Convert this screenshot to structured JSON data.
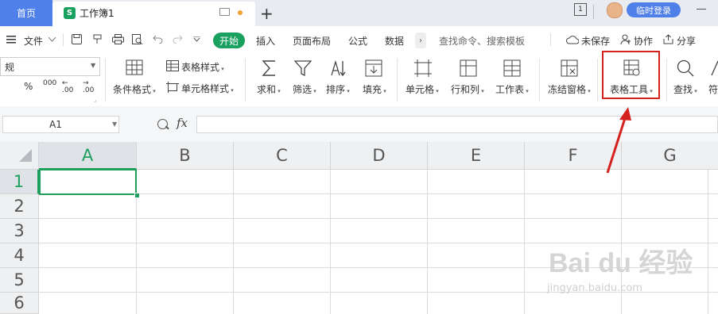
{
  "titlebar": {
    "home_tab": "首页",
    "doc_icon_letter": "S",
    "doc_title": "工作簿1",
    "new_tab": "+",
    "window_number": "1",
    "login_button": "临时登录"
  },
  "menubar": {
    "file_menu": "文件",
    "start_tab": "开始",
    "items": [
      "插入",
      "页面布局",
      "公式",
      "数据"
    ],
    "more": "›",
    "search_placeholder": "查找命令、搜索模板",
    "unsaved": "未保存",
    "collaborate": "协作",
    "share": "分享"
  },
  "ribbon": {
    "font_combo_value": "规",
    "percent": "%",
    "thousands": "000",
    "dec_increase": ".00",
    "dec_decrease": ".00",
    "conditional_format": "条件格式",
    "table_style": "表格样式",
    "cell_style": "单元格样式",
    "sum": "求和",
    "filter": "筛选",
    "sort": "排序",
    "fill": "填充",
    "cell": "单元格",
    "row_col": "行和列",
    "worksheet": "工作表",
    "freeze": "冻结窗格",
    "table_tools": "表格工具",
    "find": "查找",
    "symbol": "符"
  },
  "formula_bar": {
    "name_box": "A1",
    "fx": "fx",
    "formula": ""
  },
  "grid": {
    "columns": [
      "A",
      "B",
      "C",
      "D",
      "E",
      "F",
      "G"
    ],
    "rows": [
      "1",
      "2",
      "3",
      "4",
      "5",
      "6"
    ],
    "selected_cell": "A1"
  },
  "watermark": {
    "logo": "Bai du 经验",
    "url": "jingyan.baidu.com"
  },
  "colors": {
    "accent_blue": "#4f7fe8",
    "accent_green": "#1aa05f",
    "highlight_red": "#d6221f"
  }
}
